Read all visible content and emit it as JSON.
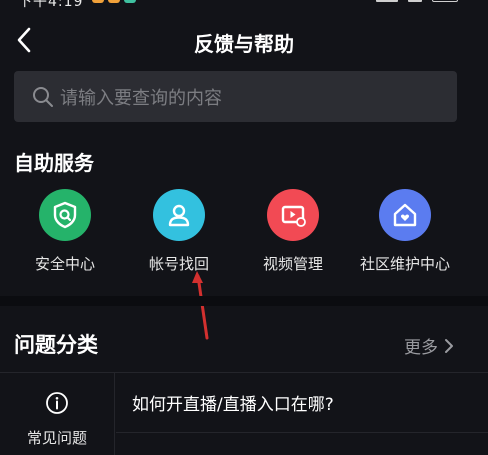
{
  "header": {
    "title": "反馈与帮助"
  },
  "search": {
    "placeholder": "请输入要查询的内容"
  },
  "self_service": {
    "title": "自助服务",
    "items": [
      {
        "label": "安全中心",
        "icon": "shield-search-icon",
        "color": "#25b36a"
      },
      {
        "label": "帐号找回",
        "icon": "user-icon",
        "color": "#33c1df"
      },
      {
        "label": "视频管理",
        "icon": "video-settings-icon",
        "color": "#f24a54"
      },
      {
        "label": "社区维护中心",
        "icon": "home-heart-icon",
        "color": "#5b7cf0"
      }
    ]
  },
  "categories": {
    "title": "问题分类",
    "more_label": "更多",
    "side_label": "常见问题",
    "questions": [
      "如何开直播/直播入口在哪?"
    ]
  },
  "colors": {
    "background": "#121318",
    "annotation_arrow": "#d3302f"
  }
}
